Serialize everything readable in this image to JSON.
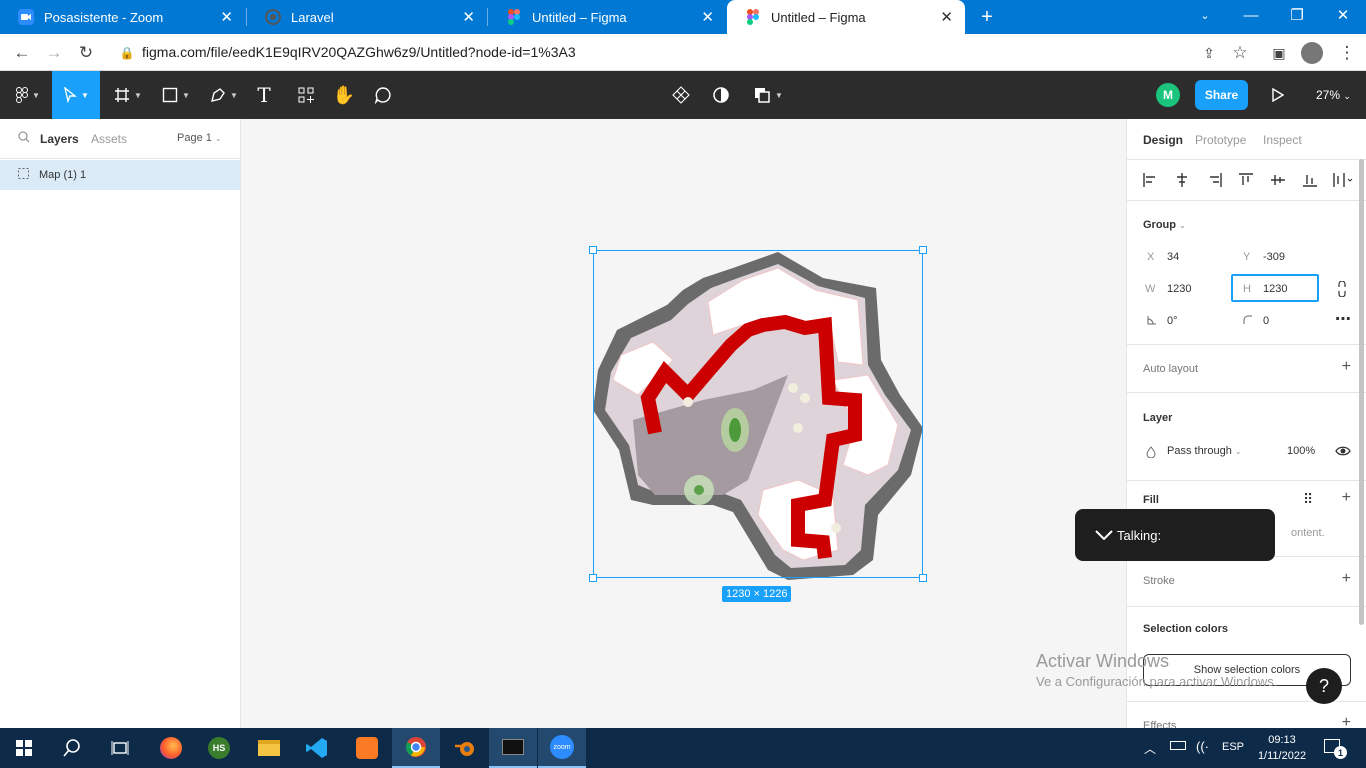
{
  "browser": {
    "tabs": [
      {
        "title": "Posasistente - Zoom",
        "icon": "zoom-icon"
      },
      {
        "title": "Laravel",
        "icon": "globe-icon"
      },
      {
        "title": "Untitled – Figma",
        "icon": "figma-icon"
      },
      {
        "title": "Untitled – Figma",
        "icon": "figma-icon",
        "active": true
      }
    ],
    "url": "figma.com/file/eedK1E9qIRV20QAZGhw6z9/Untitled?node-id=1%3A3"
  },
  "figma": {
    "toolbar": {
      "share_label": "Share",
      "avatar_letter": "M",
      "zoom": "27%"
    },
    "left_panel": {
      "tabs": [
        "Layers",
        "Assets"
      ],
      "page": "Page 1",
      "layers": [
        {
          "name": "Map (1) 1"
        }
      ]
    },
    "canvas": {
      "selection_size": "1230 × 1226"
    },
    "right_panel": {
      "tabs": [
        "Design",
        "Prototype",
        "Inspect"
      ],
      "group_label": "Group",
      "x_label": "X",
      "x_value": "34",
      "y_label": "Y",
      "y_value": "-309",
      "w_label": "W",
      "w_value": "1230",
      "h_label": "H",
      "h_value": "1230",
      "rotation": "0°",
      "radius": "0",
      "auto_layout": "Auto layout",
      "layer_title": "Layer",
      "blend_mode": "Pass through",
      "opacity": "100%",
      "fill_title": "Fill",
      "fill_note": "ontent.",
      "stroke_title": "Stroke",
      "selection_colors_title": "Selection colors",
      "show_selection_colors": "Show selection colors",
      "effects_title": "Effects"
    }
  },
  "zoom_overlay": {
    "label": "Talking:"
  },
  "windows": {
    "watermark_line1": "Activar Windows",
    "watermark_line2": "Ve a Configuración para activar Windows.",
    "taskbar": {
      "lang": "ESP",
      "time": "09:13",
      "date": "1/11/2022",
      "notifications": "1"
    }
  },
  "colors": {
    "accent": "#18a0fb",
    "toolbar": "#2c2c2c",
    "tabbar": "#0078d4",
    "taskbar": "#0d2a48",
    "map_red": "#cc0000"
  }
}
